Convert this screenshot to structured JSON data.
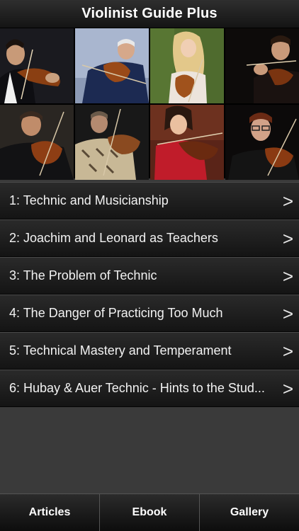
{
  "header": {
    "title": "Violinist Guide Plus"
  },
  "gallery": {
    "photos": [
      {
        "icon": "violinist-photo-1"
      },
      {
        "icon": "violinist-photo-2"
      },
      {
        "icon": "violinist-photo-3"
      },
      {
        "icon": "violinist-photo-4"
      },
      {
        "icon": "violinist-photo-5"
      },
      {
        "icon": "violinist-photo-6"
      },
      {
        "icon": "violinist-photo-7"
      },
      {
        "icon": "violinist-photo-8"
      }
    ]
  },
  "articles": [
    {
      "label": "1: Technic and Musicianship",
      "chevron": ">"
    },
    {
      "label": "2: Joachim and Leonard as Teachers",
      "chevron": ">"
    },
    {
      "label": "3: The Problem of Technic",
      "chevron": ">"
    },
    {
      "label": "4: The Danger of Practicing Too Much",
      "chevron": ">"
    },
    {
      "label": "5: Technical Mastery and Temperament",
      "chevron": ">"
    },
    {
      "label": "6: Hubay & Auer Technic - Hints to the Stud...",
      "chevron": ">"
    }
  ],
  "tabs": [
    {
      "label": "Articles"
    },
    {
      "label": "Ebook"
    },
    {
      "label": "Gallery"
    }
  ],
  "colors": {
    "background": "#3a3a3a",
    "bar": "#141414",
    "text": "#ffffff"
  }
}
